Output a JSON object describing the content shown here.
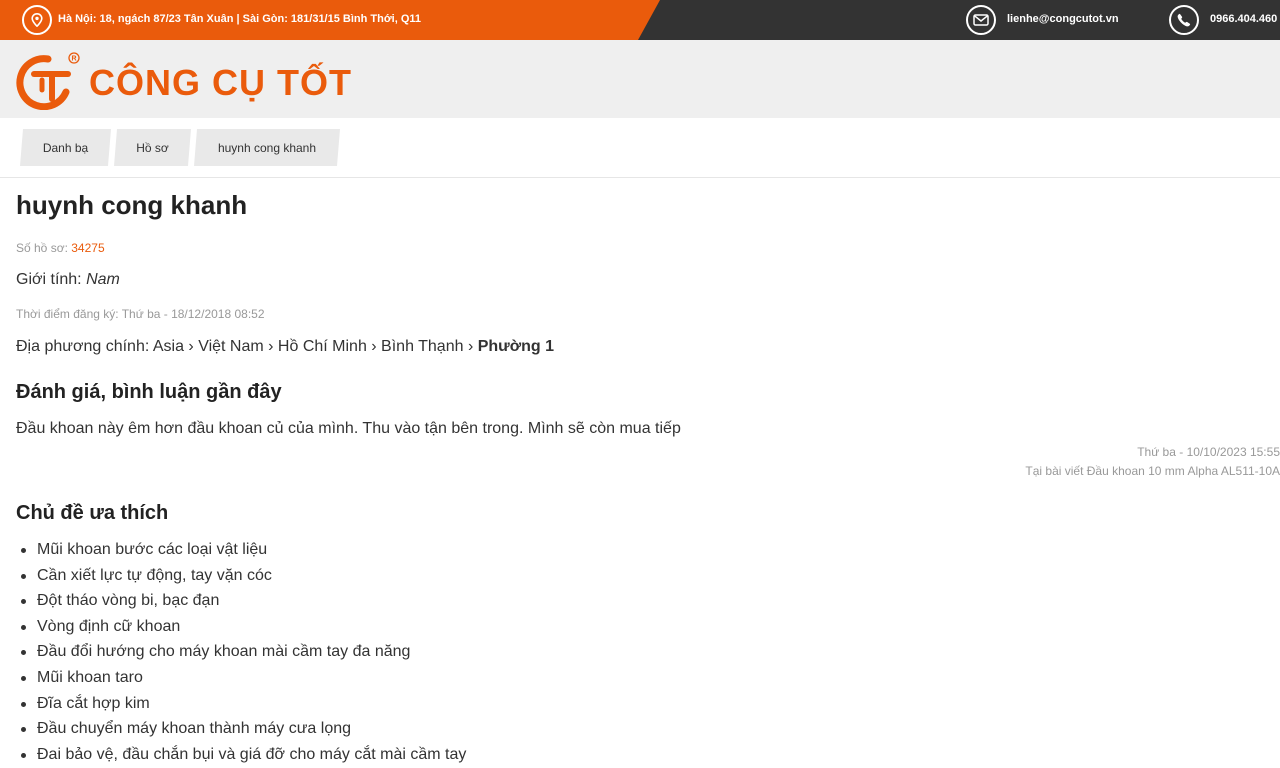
{
  "topbar": {
    "address": "Hà Nội: 18, ngách 87/23 Tân Xuân | Sài Gòn: 181/31/15 Bình Thới, Q11",
    "email": "lienhe@congcutot.vn",
    "phone": "0966.404.460",
    "icons": [
      "location-pin-icon",
      "envelope-icon",
      "phone-icon"
    ]
  },
  "header": {
    "logo_text": "CÔNG CỤ TỐT",
    "registered_mark": "®",
    "brand_color": "#ea5b0c"
  },
  "breadcrumb": [
    "Danh bạ",
    "Hồ sơ",
    "huynh cong khanh"
  ],
  "profile": {
    "name": "huynh cong khanh",
    "profile_no_label": "Số hồ sơ:",
    "profile_no": "34275",
    "gender_label": "Giới tính:",
    "gender": "Nam",
    "registered_at": "Thời điểm đăng ký: Thứ ba - 18/12/2018 08:52",
    "location_label": "Địa phương chính:",
    "location_path": "Asia › Việt Nam › Hồ Chí Minh › Bình Thạnh ›",
    "location_final": "Phường 1"
  },
  "reviews": {
    "title": "Đánh giá, bình luận gần đây",
    "items": [
      {
        "text": "Đầu khoan này êm hơn đầu khoan củ của mình. Thu vào tận bên trong. Mình sẽ còn mua tiếp",
        "date": "Thứ ba - 10/10/2023 15:55",
        "source": "Tại bài viết Đầu khoan 10 mm Alpha AL511-10A"
      }
    ]
  },
  "favorites": {
    "title": "Chủ đề ưa thích",
    "items": [
      "Mũi khoan bước các loại vật liệu",
      "Cần xiết lực tự động, tay vặn cóc",
      "Đột tháo vòng bi, bạc đạn",
      "Vòng định cữ khoan",
      "Đầu đổi hướng cho máy khoan mài cầm tay đa năng",
      "Mũi khoan taro",
      "Đĩa cắt hợp kim",
      "Đầu chuyển máy khoan thành máy cưa lọng",
      "Đai bảo vệ, đầu chắn bụi và giá đỡ cho máy cắt mài cầm tay"
    ]
  }
}
